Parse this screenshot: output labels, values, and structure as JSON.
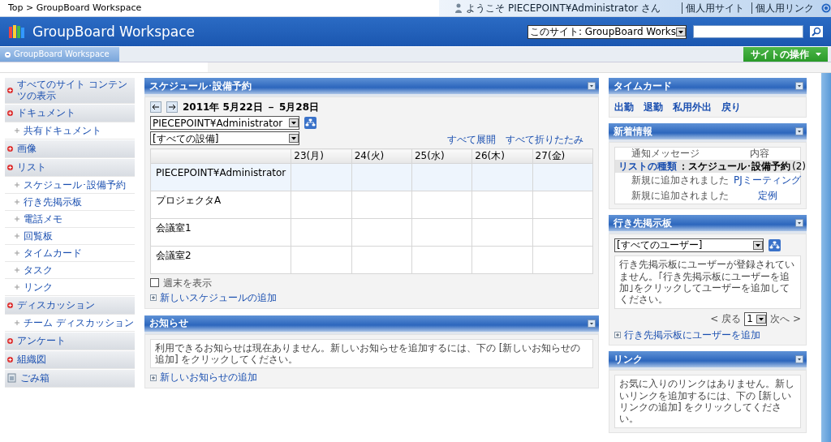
{
  "top_bar": {
    "breadcrumb": "Top > GroupBoard Workspace",
    "welcome": "ようこそ PIECEPOINT¥Administrator さん",
    "links": [
      "個人用サイト",
      "個人用リンク"
    ]
  },
  "header": {
    "title": "GroupBoard Workspace",
    "scope": "このサイト: GroupBoard Works"
  },
  "nav": {
    "tab": "GroupBoard Workspace",
    "actions": "サイトの操作"
  },
  "sidebar": [
    {
      "kind": "section",
      "label": "すべてのサイト コンテンツの表示"
    },
    {
      "kind": "section",
      "label": "ドキュメント"
    },
    {
      "kind": "sub",
      "label": "共有ドキュメント"
    },
    {
      "kind": "section",
      "label": "画像"
    },
    {
      "kind": "section",
      "label": "リスト"
    },
    {
      "kind": "sub",
      "label": "スケジュール･設備予約"
    },
    {
      "kind": "sub",
      "label": "行き先掲示板"
    },
    {
      "kind": "sub",
      "label": "電話メモ"
    },
    {
      "kind": "sub",
      "label": "回覧板"
    },
    {
      "kind": "sub",
      "label": "タイムカード"
    },
    {
      "kind": "sub",
      "label": "タスク"
    },
    {
      "kind": "sub",
      "label": "リンク"
    },
    {
      "kind": "section",
      "label": "ディスカッション"
    },
    {
      "kind": "sub",
      "label": "チーム ディスカッション"
    },
    {
      "kind": "section",
      "label": "アンケート"
    },
    {
      "kind": "section",
      "label": "組織図"
    },
    {
      "kind": "trash",
      "label": "ごみ箱"
    }
  ],
  "schedule": {
    "title": "スケジュール･設備予約",
    "range": "2011年 5月22日 － 5月28日",
    "user_select": "PIECEPOINT¥Administrator",
    "equipment_select": "[すべての設備]",
    "expand_all": "すべて展開",
    "collapse_all": "すべて折りたたみ",
    "columns": [
      "23(月)",
      "24(火)",
      "25(水)",
      "26(木)",
      "27(金)"
    ],
    "rows": [
      {
        "label": "PIECEPOINT¥Administrator",
        "selected": true
      },
      {
        "label": "プロジェクタA",
        "selected": false
      },
      {
        "label": "会議室1",
        "selected": false
      },
      {
        "label": "会議室2",
        "selected": false
      }
    ],
    "show_weekend": {
      "label": "週末を表示",
      "checked": false
    },
    "add_link": "新しいスケジュールの追加"
  },
  "notices": {
    "title": "お知らせ",
    "message": "利用できるお知らせは現在ありません。新しいお知らせを追加するには、下の [新しいお知らせの追加] をクリックしてください。",
    "add_link": "新しいお知らせの追加"
  },
  "timecard": {
    "title": "タイムカード",
    "links": [
      "出勤",
      "退勤",
      "私用外出",
      "戻り"
    ]
  },
  "news": {
    "title": "新着情報",
    "columns": [
      "通知メッセージ",
      "内容"
    ],
    "group_label": "リストの種類",
    "group_value": "：スケジュール･設備予約",
    "group_count": "(2)",
    "rows": [
      {
        "message": "新規に追加されました",
        "item": "PJミーティング"
      },
      {
        "message": "新規に追加されました",
        "item": "定例"
      }
    ]
  },
  "destination": {
    "title": "行き先掲示板",
    "user_select": "[すべてのユーザー]",
    "message": "行き先掲示板にユーザーが登録されていません。｢行き先掲示板にユーザーを追加｣をクリックしてユーザーを追加してください。",
    "prev": "< 戻る",
    "page": "1",
    "next": "次へ >",
    "add_link": "行き先掲示板にユーザーを追加"
  },
  "links_panel": {
    "title": "リンク",
    "message": "お気に入りのリンクはありません。新しいリンクを追加するには、下の [新しいリンクの追加] をクリックしてください。"
  }
}
